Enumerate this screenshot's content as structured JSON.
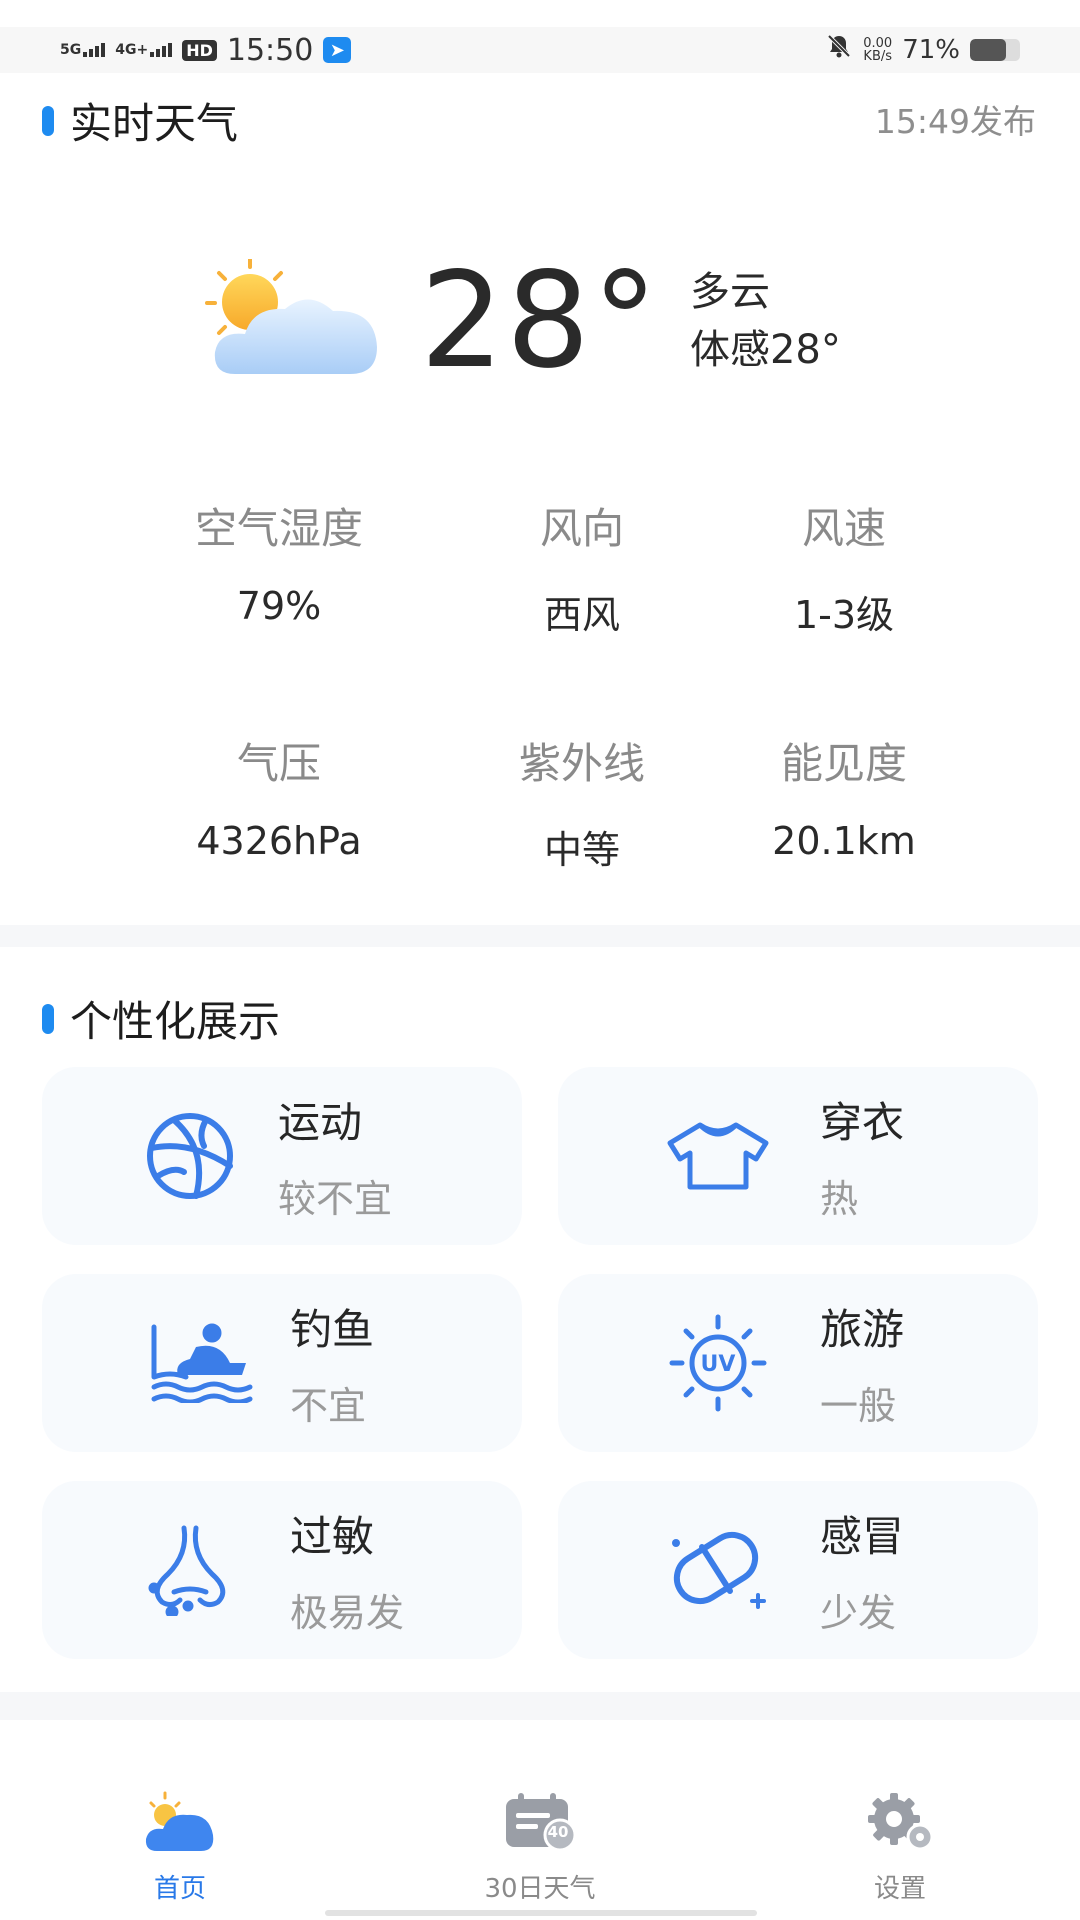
{
  "status_bar": {
    "network1": "5G",
    "network2": "4G+",
    "hd": "HD",
    "time": "15:50",
    "speed_value": "0.00",
    "speed_unit": "KB/s",
    "battery": "71%",
    "battery_level": 0.71
  },
  "realtime": {
    "title": "实时天气",
    "publish_time": "15:49发布",
    "temperature": "28°",
    "condition": "多云",
    "feels_like": "体感28°",
    "weather_icon": "partly-cloudy-icon"
  },
  "details": [
    {
      "label": "空气湿度",
      "value": "79%"
    },
    {
      "label": "风向",
      "value": "西风"
    },
    {
      "label": "风速",
      "value": "1-3级"
    },
    {
      "label": "气压",
      "value": "4326hPa"
    },
    {
      "label": "紫外线",
      "value": "中等"
    },
    {
      "label": "能见度",
      "value": "20.1km"
    }
  ],
  "personal": {
    "title": "个性化展示",
    "cards": [
      {
        "title": "运动",
        "sub": "较不宜",
        "icon": "basketball-icon"
      },
      {
        "title": "穿衣",
        "sub": "热",
        "icon": "shirt-icon"
      },
      {
        "title": "钓鱼",
        "sub": "不宜",
        "icon": "fishing-icon"
      },
      {
        "title": "旅游",
        "sub": "一般",
        "icon": "uv-sun-icon"
      },
      {
        "title": "过敏",
        "sub": "极易发",
        "icon": "nose-icon"
      },
      {
        "title": "感冒",
        "sub": "少发",
        "icon": "pill-icon"
      }
    ]
  },
  "nav": {
    "items": [
      {
        "label": "首页",
        "icon": "home-weather-icon",
        "active": true
      },
      {
        "label": "30日天气",
        "icon": "calendar-icon",
        "badge": "40",
        "active": false
      },
      {
        "label": "设置",
        "icon": "gear-icon",
        "active": false
      }
    ]
  },
  "colors": {
    "accent": "#1e8bf0",
    "icon_blue": "#3b7de8",
    "card_bg": "#f7fafd"
  }
}
